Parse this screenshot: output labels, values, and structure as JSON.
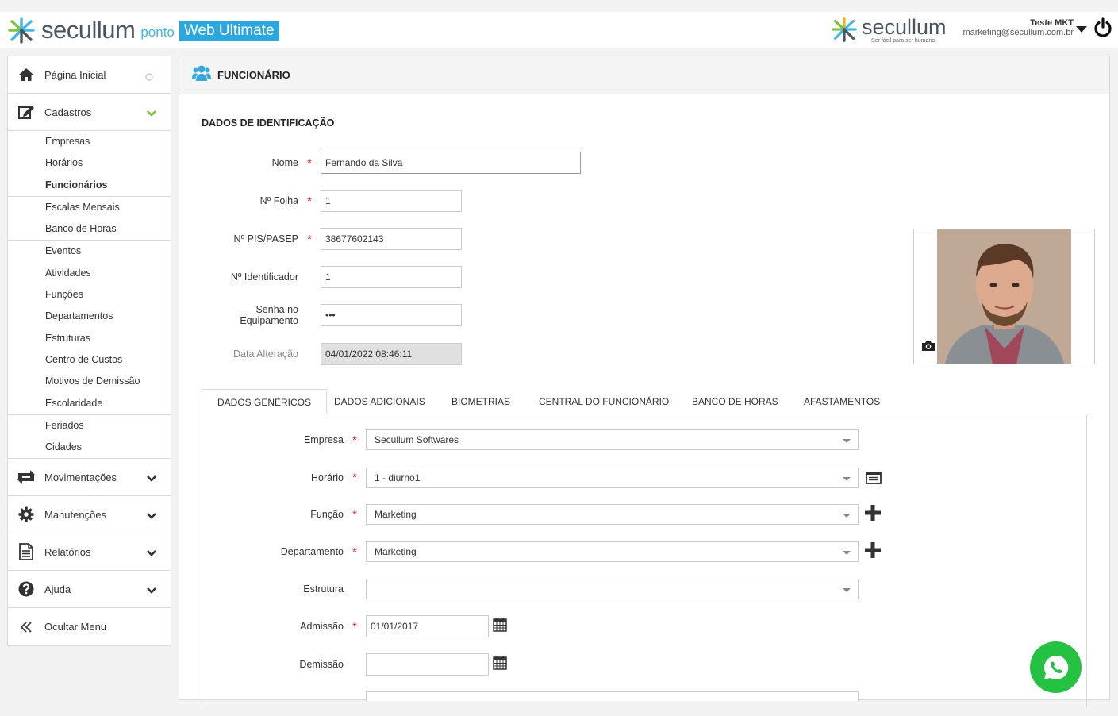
{
  "header": {
    "logo_name": "secullum",
    "logo_ponto": "ponto",
    "logo_badge": "Web Ultimate",
    "brand_name": "secullum",
    "brand_slogan": "Ser fácil para ser humano.",
    "user_name": "Teste MKT",
    "user_email": "marketing@secullum.com.br"
  },
  "sidebar": {
    "home": "Página Inicial",
    "cadastros": "Cadastros",
    "sub_groups": [
      [
        "Empresas",
        "Horários",
        "Funcionários"
      ],
      [
        "Escalas Mensais",
        "Banco de Horas"
      ],
      [
        "Eventos",
        "Atividades",
        "Funções",
        "Departamentos",
        "Estruturas",
        "Centro de Custos",
        "Motivos de Demissão",
        "Escolaridade"
      ],
      [
        "Feriados",
        "Cidades"
      ]
    ],
    "movimentacoes": "Movimentações",
    "manutencoes": "Manutenções",
    "relatorios": "Relatórios",
    "ajuda": "Ajuda",
    "ocultar": "Ocultar Menu"
  },
  "page": {
    "title": "FUNCIONÁRIO",
    "section": "DADOS DE IDENTIFICAÇÃO"
  },
  "form": {
    "nome_label": "Nome",
    "nome_value": "Fernando da Silva",
    "folha_label": "Nº Folha",
    "folha_value": "1",
    "pis_label": "Nº PIS/PASEP",
    "pis_value": "38677602143",
    "ident_label": "Nº Identificador",
    "ident_value": "1",
    "senha_label1": "Senha no",
    "senha_label2": "Equipamento",
    "senha_value": "•••",
    "data_label": "Data Alteração",
    "data_value": "04/01/2022 08:46:11"
  },
  "tabs": [
    "DADOS GENÉRICOS",
    "DADOS ADICIONAIS",
    "BIOMETRIAS",
    "CENTRAL DO FUNCIONÁRIO",
    "BANCO DE HORAS",
    "AFASTAMENTOS"
  ],
  "generic": {
    "empresa_label": "Empresa",
    "empresa_value": "Secullum Softwares",
    "horario_label": "Horário",
    "horario_value": "1 - diurno1",
    "funcao_label": "Função",
    "funcao_value": "Marketing",
    "depto_label": "Departamento",
    "depto_value": "Marketing",
    "estrutura_label": "Estrutura",
    "estrutura_value": "",
    "admissao_label": "Admissão",
    "admissao_value": "01/01/2017",
    "demissao_label": "Demissão",
    "demissao_value": ""
  },
  "required_mark": "*"
}
